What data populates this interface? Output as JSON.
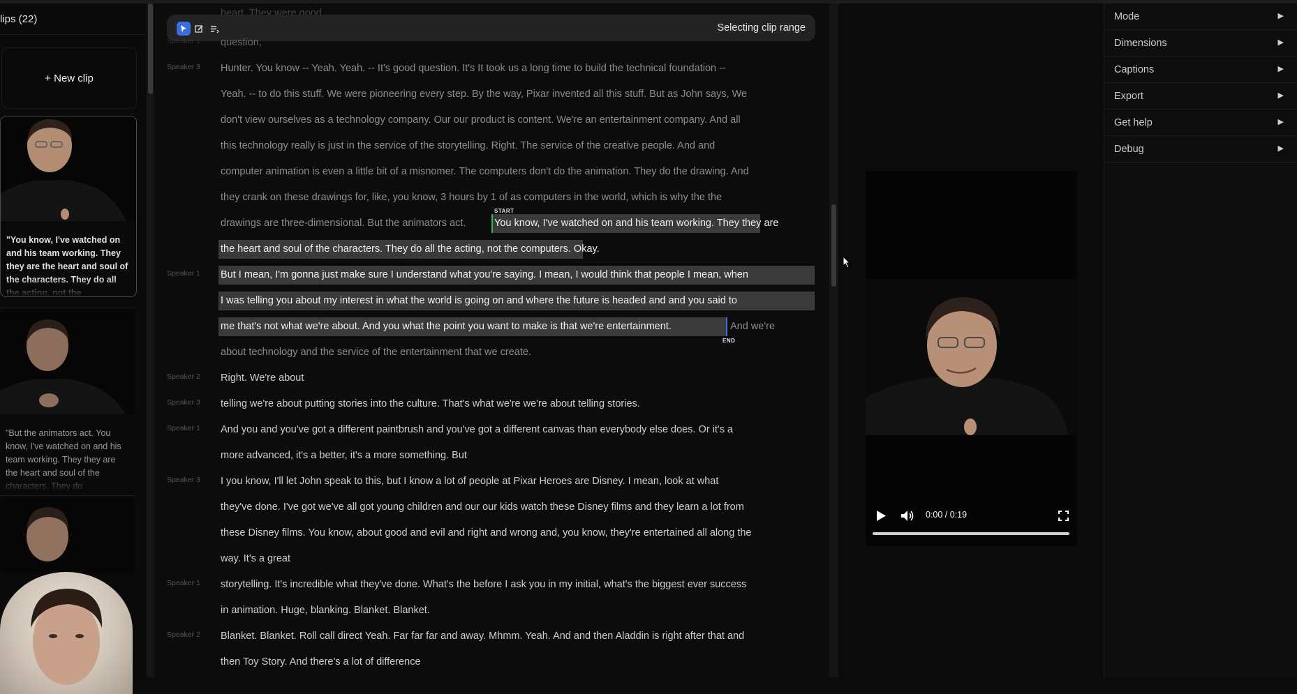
{
  "clips": {
    "header": "lips (22)",
    "new_clip_label": "+ New clip",
    "items": [
      {
        "quote": "\"You know, I've watched on and his team working. They they are the heart and soul of the characters. They do all the acting, not the"
      },
      {
        "quote": "\"But the animators act. You know, I've watched on and his team working. They they are the heart and soul of the characters. They do"
      }
    ]
  },
  "toolbar": {
    "status": "Selecting clip range",
    "tools": [
      "cursor-icon",
      "edit-icon",
      "list-icon"
    ]
  },
  "transcript": {
    "top_fragment": "heart. They were good",
    "lines": [
      {
        "speaker": "Speaker 1",
        "text": "question,"
      },
      {
        "speaker": "Speaker 3",
        "text": "Hunter. You know -- Yeah. Yeah. -- It's good question. It's It took us a long time to build the technical foundation --"
      },
      {
        "speaker": "",
        "text": "Yeah. -- to do this stuff. We were pioneering every step. By the way, Pixar invented all this stuff. But as John says, We"
      },
      {
        "speaker": "",
        "text": "don't view ourselves as a technology company. Our our product is content. We're an entertainment company. And all"
      },
      {
        "speaker": "",
        "text": "this technology really is just in the service of the storytelling. Right. The service of the creative people. And and"
      },
      {
        "speaker": "",
        "text": "computer animation is even a little bit of a misnomer. The computers don't do the animation. They do the drawing. And"
      },
      {
        "speaker": "",
        "text": "they crank on these drawings for, like, you know, 3 hours by 1 of as computers in the world, which is why the the"
      },
      {
        "speaker": "",
        "text": "drawings are three-dimensional. But the animators act.",
        "highlight": "You know, I've watched on and his team working. They they are"
      },
      {
        "speaker": "",
        "highlight": "the heart and soul of the characters. They do all the acting, not the computers. Okay."
      },
      {
        "speaker": "Speaker 1",
        "highlight": "But I mean, I'm gonna just make sure I understand what you're saying. I mean, I would think that people I mean, when"
      },
      {
        "speaker": "",
        "highlight": "I was telling you about my interest in what the world is going on and where the future is headed and and you said to"
      },
      {
        "speaker": "",
        "highlight": "me that's not what we're about. And you what the point you want to make is that we're entertainment.",
        "text": "And we're"
      },
      {
        "speaker": "",
        "text": "about technology and the service of the entertainment that we create."
      },
      {
        "speaker": "Speaker 2",
        "text": "Right. We're about"
      },
      {
        "speaker": "Speaker 3",
        "text": "telling we're about putting stories into the culture. That's what we're we're about telling stories."
      },
      {
        "speaker": "Speaker 1",
        "text": "And you and you've got a different paintbrush and you've got a different canvas than everybody else does. Or it's a"
      },
      {
        "speaker": "",
        "text": "more advanced, it's a better, it's a more something. But"
      },
      {
        "speaker": "Speaker 3",
        "text": "I you know, I'll let John speak to this, but I know a lot of people at Pixar Heroes are Disney. I mean, look at what"
      },
      {
        "speaker": "",
        "text": "they've done. I've got we've all got young children and our our kids watch these Disney films and they learn a lot from"
      },
      {
        "speaker": "",
        "text": "these Disney films. You know, about good and evil and right and wrong and, you know, they're entertained all along the"
      },
      {
        "speaker": "",
        "text": "way. It's a great"
      },
      {
        "speaker": "Speaker 1",
        "text": "storytelling. It's incredible what they've done. What's the before I ask you in my initial, what's the biggest ever success"
      },
      {
        "speaker": "",
        "text": "in animation. Huge, blanking. Blanket. Blanket."
      },
      {
        "speaker": "Speaker 2",
        "text": "Blanket. Blanket. Roll call direct Yeah. Far far far and away. Mhmm. Yeah. And and then Aladdin is right after that and"
      },
      {
        "speaker": "",
        "text": "then Toy Story. And there's a lot of difference"
      }
    ],
    "start_marker": "START",
    "end_marker": "END"
  },
  "player": {
    "time": "0:00 / 0:19",
    "progress": 0.0
  },
  "menu": {
    "items": [
      "Mode",
      "Dimensions",
      "Captions",
      "Export",
      "Get help",
      "Debug"
    ]
  }
}
